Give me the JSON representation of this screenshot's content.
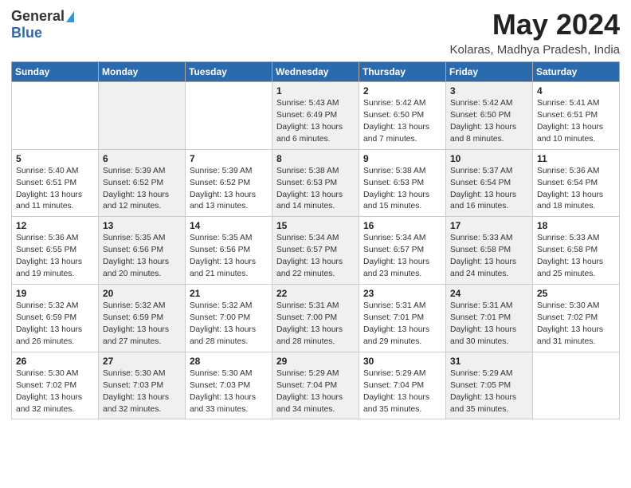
{
  "logo": {
    "general": "General",
    "blue": "Blue"
  },
  "title": "May 2024",
  "location": "Kolaras, Madhya Pradesh, India",
  "weekdays": [
    "Sunday",
    "Monday",
    "Tuesday",
    "Wednesday",
    "Thursday",
    "Friday",
    "Saturday"
  ],
  "weeks": [
    [
      {
        "day": null,
        "info": null,
        "shaded": false
      },
      {
        "day": null,
        "info": null,
        "shaded": true
      },
      {
        "day": null,
        "info": null,
        "shaded": false
      },
      {
        "day": "1",
        "info": "Sunrise: 5:43 AM\nSunset: 6:49 PM\nDaylight: 13 hours\nand 6 minutes.",
        "shaded": true
      },
      {
        "day": "2",
        "info": "Sunrise: 5:42 AM\nSunset: 6:50 PM\nDaylight: 13 hours\nand 7 minutes.",
        "shaded": false
      },
      {
        "day": "3",
        "info": "Sunrise: 5:42 AM\nSunset: 6:50 PM\nDaylight: 13 hours\nand 8 minutes.",
        "shaded": true
      },
      {
        "day": "4",
        "info": "Sunrise: 5:41 AM\nSunset: 6:51 PM\nDaylight: 13 hours\nand 10 minutes.",
        "shaded": false
      }
    ],
    [
      {
        "day": "5",
        "info": "Sunrise: 5:40 AM\nSunset: 6:51 PM\nDaylight: 13 hours\nand 11 minutes.",
        "shaded": false
      },
      {
        "day": "6",
        "info": "Sunrise: 5:39 AM\nSunset: 6:52 PM\nDaylight: 13 hours\nand 12 minutes.",
        "shaded": true
      },
      {
        "day": "7",
        "info": "Sunrise: 5:39 AM\nSunset: 6:52 PM\nDaylight: 13 hours\nand 13 minutes.",
        "shaded": false
      },
      {
        "day": "8",
        "info": "Sunrise: 5:38 AM\nSunset: 6:53 PM\nDaylight: 13 hours\nand 14 minutes.",
        "shaded": true
      },
      {
        "day": "9",
        "info": "Sunrise: 5:38 AM\nSunset: 6:53 PM\nDaylight: 13 hours\nand 15 minutes.",
        "shaded": false
      },
      {
        "day": "10",
        "info": "Sunrise: 5:37 AM\nSunset: 6:54 PM\nDaylight: 13 hours\nand 16 minutes.",
        "shaded": true
      },
      {
        "day": "11",
        "info": "Sunrise: 5:36 AM\nSunset: 6:54 PM\nDaylight: 13 hours\nand 18 minutes.",
        "shaded": false
      }
    ],
    [
      {
        "day": "12",
        "info": "Sunrise: 5:36 AM\nSunset: 6:55 PM\nDaylight: 13 hours\nand 19 minutes.",
        "shaded": false
      },
      {
        "day": "13",
        "info": "Sunrise: 5:35 AM\nSunset: 6:56 PM\nDaylight: 13 hours\nand 20 minutes.",
        "shaded": true
      },
      {
        "day": "14",
        "info": "Sunrise: 5:35 AM\nSunset: 6:56 PM\nDaylight: 13 hours\nand 21 minutes.",
        "shaded": false
      },
      {
        "day": "15",
        "info": "Sunrise: 5:34 AM\nSunset: 6:57 PM\nDaylight: 13 hours\nand 22 minutes.",
        "shaded": true
      },
      {
        "day": "16",
        "info": "Sunrise: 5:34 AM\nSunset: 6:57 PM\nDaylight: 13 hours\nand 23 minutes.",
        "shaded": false
      },
      {
        "day": "17",
        "info": "Sunrise: 5:33 AM\nSunset: 6:58 PM\nDaylight: 13 hours\nand 24 minutes.",
        "shaded": true
      },
      {
        "day": "18",
        "info": "Sunrise: 5:33 AM\nSunset: 6:58 PM\nDaylight: 13 hours\nand 25 minutes.",
        "shaded": false
      }
    ],
    [
      {
        "day": "19",
        "info": "Sunrise: 5:32 AM\nSunset: 6:59 PM\nDaylight: 13 hours\nand 26 minutes.",
        "shaded": false
      },
      {
        "day": "20",
        "info": "Sunrise: 5:32 AM\nSunset: 6:59 PM\nDaylight: 13 hours\nand 27 minutes.",
        "shaded": true
      },
      {
        "day": "21",
        "info": "Sunrise: 5:32 AM\nSunset: 7:00 PM\nDaylight: 13 hours\nand 28 minutes.",
        "shaded": false
      },
      {
        "day": "22",
        "info": "Sunrise: 5:31 AM\nSunset: 7:00 PM\nDaylight: 13 hours\nand 28 minutes.",
        "shaded": true
      },
      {
        "day": "23",
        "info": "Sunrise: 5:31 AM\nSunset: 7:01 PM\nDaylight: 13 hours\nand 29 minutes.",
        "shaded": false
      },
      {
        "day": "24",
        "info": "Sunrise: 5:31 AM\nSunset: 7:01 PM\nDaylight: 13 hours\nand 30 minutes.",
        "shaded": true
      },
      {
        "day": "25",
        "info": "Sunrise: 5:30 AM\nSunset: 7:02 PM\nDaylight: 13 hours\nand 31 minutes.",
        "shaded": false
      }
    ],
    [
      {
        "day": "26",
        "info": "Sunrise: 5:30 AM\nSunset: 7:02 PM\nDaylight: 13 hours\nand 32 minutes.",
        "shaded": false
      },
      {
        "day": "27",
        "info": "Sunrise: 5:30 AM\nSunset: 7:03 PM\nDaylight: 13 hours\nand 32 minutes.",
        "shaded": true
      },
      {
        "day": "28",
        "info": "Sunrise: 5:30 AM\nSunset: 7:03 PM\nDaylight: 13 hours\nand 33 minutes.",
        "shaded": false
      },
      {
        "day": "29",
        "info": "Sunrise: 5:29 AM\nSunset: 7:04 PM\nDaylight: 13 hours\nand 34 minutes.",
        "shaded": true
      },
      {
        "day": "30",
        "info": "Sunrise: 5:29 AM\nSunset: 7:04 PM\nDaylight: 13 hours\nand 35 minutes.",
        "shaded": false
      },
      {
        "day": "31",
        "info": "Sunrise: 5:29 AM\nSunset: 7:05 PM\nDaylight: 13 hours\nand 35 minutes.",
        "shaded": true
      },
      {
        "day": null,
        "info": null,
        "shaded": false
      }
    ]
  ]
}
